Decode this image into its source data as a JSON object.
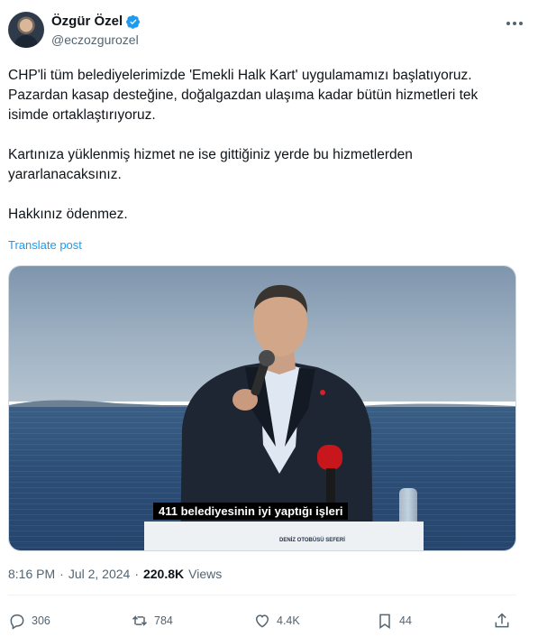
{
  "author": {
    "name": "Özgür Özel",
    "handle": "@eczozgurozel"
  },
  "post": {
    "paragraph1": "CHP'li tüm belediyelerimizde 'Emekli Halk Kart' uygulamamızı başlatıyoruz. Pazardan kasap desteğine, doğalgazdan ulaşıma kadar bütün hizmetleri tek isimde ortaklaştırıyoruz.",
    "paragraph2": "Kartınıza yüklenmiş hizmet ne ise gittiğiniz yerde bu hizmetlerden yararlanacaksınız.",
    "paragraph3": "Hakkınız ödenmez.",
    "translate_label": "Translate post"
  },
  "media": {
    "caption": "411 belediyesinin iyi yaptığı işleri",
    "podium_text": "DENİZ OTOBÜSÜ SEFERİ"
  },
  "meta": {
    "time": "8:16 PM",
    "separator": "·",
    "date": "Jul 2, 2024",
    "views_count": "220.8K",
    "views_label": "Views"
  },
  "actions": {
    "replies": "306",
    "reposts": "784",
    "likes": "4.4K",
    "bookmarks": "44"
  },
  "colors": {
    "accent": "#1d9bf0",
    "muted": "#536471",
    "text": "#0f1419"
  }
}
